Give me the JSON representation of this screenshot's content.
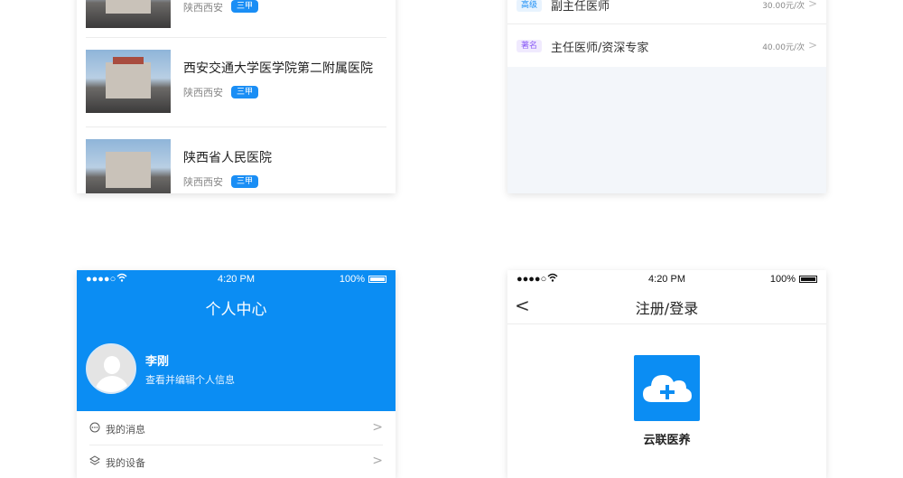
{
  "hospitals": [
    {
      "name": "",
      "location": "陕西西安",
      "tag": "三甲"
    },
    {
      "name": "西安交通大学医学院第二附属医院",
      "location": "陕西西安",
      "tag": "三甲"
    },
    {
      "name": "陕西省人民医院",
      "location": "陕西西安",
      "tag": "三甲"
    }
  ],
  "doctors": [
    {
      "level": "高级",
      "title": "副主任医师",
      "price": "30.00元/次",
      "level_color": "#1a8ef5",
      "level_bg": "#e8f3fe"
    },
    {
      "level": "著名",
      "title": "主任医师/资深专家",
      "price": "40.00元/次",
      "level_color": "#8b5cf6",
      "level_bg": "#f0eafe"
    }
  ],
  "status": {
    "signal": "●●●●○",
    "time": "4:20 PM",
    "battery": "100%"
  },
  "profile": {
    "title": "个人中心",
    "user_name": "李刚",
    "user_sub": "查看并编辑个人信息",
    "menu": [
      {
        "label": "我的消息",
        "icon": "message-icon"
      },
      {
        "label": "我的设备",
        "icon": "layers-icon"
      }
    ]
  },
  "login": {
    "title": "注册/登录",
    "app_name": "云联医养"
  },
  "colors": {
    "brand_blue": "#0b8df3"
  }
}
